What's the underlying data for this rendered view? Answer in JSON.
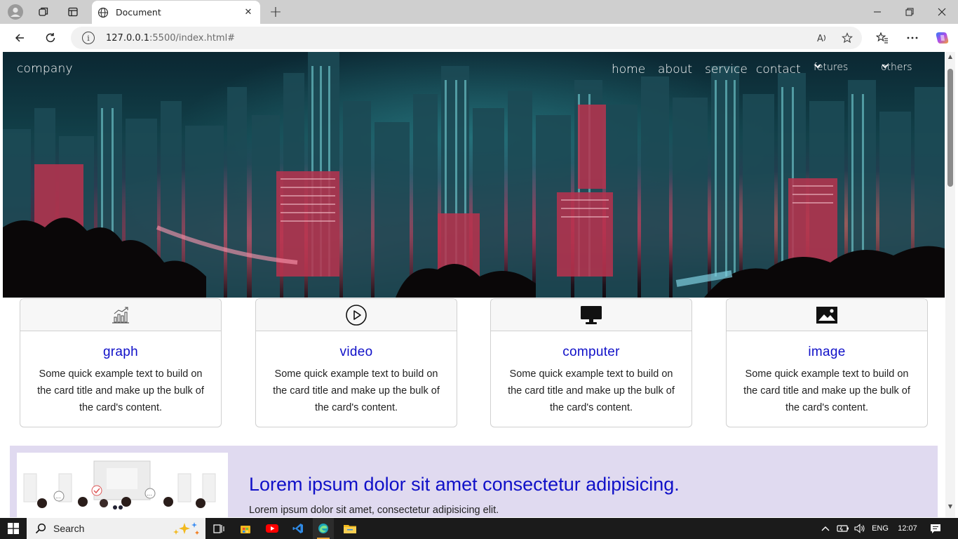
{
  "browser": {
    "tab_title": "Document",
    "url_host": "127.0.0.1",
    "url_rest": ":5500/index.html#"
  },
  "navbar": {
    "brand": "company",
    "links": [
      "home",
      "about",
      "service",
      "contact"
    ],
    "dropdowns": [
      "fetures",
      "others"
    ]
  },
  "cards": [
    {
      "icon": "bar-chart-icon",
      "title": "graph",
      "text": "Some quick example text to build on the card title and make up the bulk of the card's content."
    },
    {
      "icon": "play-circle-icon",
      "title": "video",
      "text": "Some quick example text to build on the card title and make up the bulk of the card's content."
    },
    {
      "icon": "desktop-icon",
      "title": "computer",
      "text": "Some quick example text to build on the card title and make up the bulk of the card's content."
    },
    {
      "icon": "image-icon",
      "title": "image",
      "text": "Some quick example text to build on the card title and make up the bulk of the card's content."
    }
  ],
  "promo": {
    "title": "Lorem ipsum dolor sit amet consectetur adipisicing.",
    "text": "Lorem ipsum dolor sit amet, consectetur adipisicing elit."
  },
  "taskbar": {
    "search_label": "Search",
    "language": "ENG",
    "time": "12:07"
  },
  "colors": {
    "card_title": "#1010c8",
    "promo_bg": "#e0daf0",
    "taskbar_bg": "#1b1b1b"
  }
}
